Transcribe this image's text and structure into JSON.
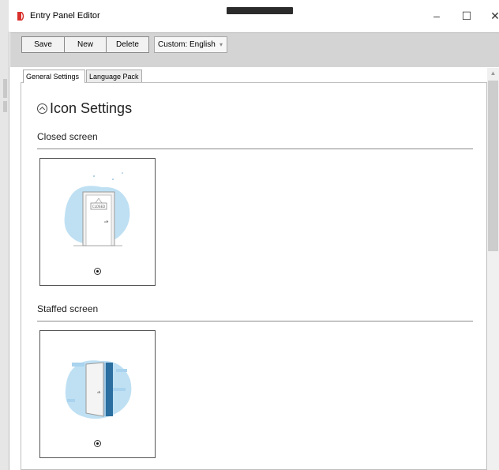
{
  "window": {
    "title": "Entry Panel Editor",
    "controls": {
      "minimize": "–",
      "maximize": "☐",
      "close": "✕"
    },
    "icon_name": "app-logo-icon",
    "accent": "#d9302c"
  },
  "toolbar": {
    "save_label": "Save",
    "new_label": "New",
    "delete_label": "Delete",
    "language_select": {
      "value": "Custom: English",
      "arrow": "▾"
    }
  },
  "tabs": [
    {
      "label": "General Settings",
      "active": true
    },
    {
      "label": "Language Pack",
      "active": false
    }
  ],
  "section": {
    "title": "Icon Settings",
    "expanded": true
  },
  "groups": [
    {
      "heading": "Closed screen",
      "illustration": "closed-door-illustration",
      "selected": true
    },
    {
      "heading": "Staffed screen",
      "illustration": "open-door-illustration",
      "selected": true
    }
  ],
  "closed_sign_text": "CLOSED",
  "colors": {
    "illustration_blob": "#bfe0f3",
    "moon": "#1f5f8c",
    "door_panel": "#2a6fa0"
  }
}
